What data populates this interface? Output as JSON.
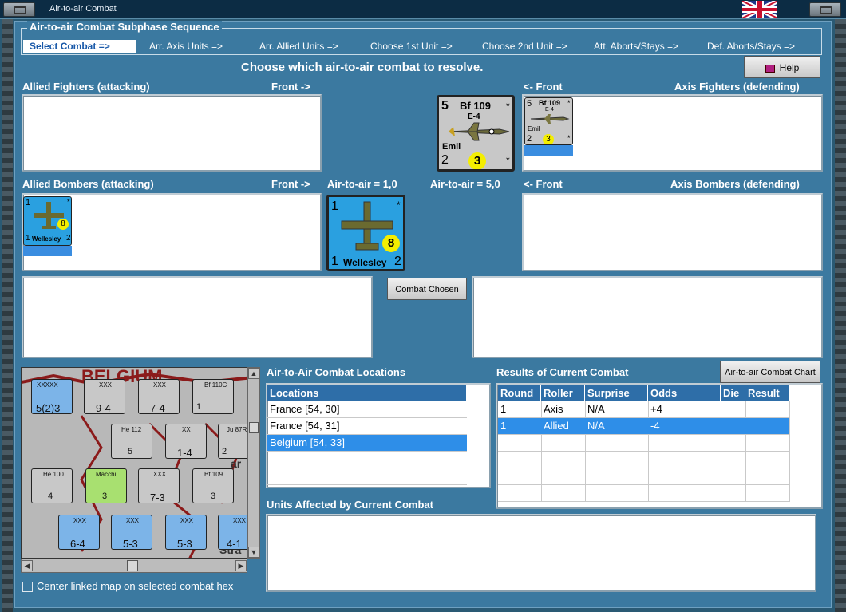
{
  "window": {
    "title": "Air-to-air Combat"
  },
  "sequence": {
    "legend": "Air-to-air Combat Subphase Sequence",
    "steps": [
      "Select Combat =>",
      "Arr. Axis Units =>",
      "Arr. Allied Units =>",
      "Choose 1st Unit =>",
      "Choose 2nd Unit =>",
      "Att. Aborts/Stays =>",
      "Def. Aborts/Stays =>"
    ]
  },
  "prompt": "Choose which air-to-air combat to resolve.",
  "help_button": "Help",
  "labels": {
    "allied_fighters": "Allied Fighters (attacking)",
    "front_right": "Front ->",
    "front_left": "<- Front",
    "axis_fighters": "Axis Fighters (defending)",
    "allied_bombers": "Allied Bombers (attacking)",
    "front_right_2": "Front ->",
    "air_allied": "Air-to-air = 1,0",
    "air_axis": "Air-to-air = 5,0",
    "front_left_2": "<- Front",
    "axis_bombers": "Axis Bombers (defending)",
    "combat_chosen": "Combat Chosen",
    "locations_title": "Air-to-Air Combat Locations",
    "results_title": "Results of Current Combat",
    "chart_button": "Air-to-air Combat Chart",
    "units_affected": "Units Affected by Current Combat",
    "center_map": "Center linked map on selected combat hex"
  },
  "units": {
    "bf109": {
      "name": "Bf 109",
      "model": "E-4",
      "pilot": "Emil",
      "air_to_air": "5",
      "range": "2",
      "cost": "3",
      "star": "*"
    },
    "wellesley": {
      "name": "Wellesley",
      "left": "1",
      "right": "2",
      "top": "1",
      "cost": "8",
      "star": "*"
    }
  },
  "locations": {
    "header": "Locations",
    "rows": [
      "France [54, 30]",
      "France [54, 31]",
      "Belgium [54, 33]"
    ],
    "selected": 2
  },
  "results": {
    "headers": [
      "Round",
      "Roller",
      "Surprise",
      "Odds",
      "Die",
      "Result"
    ],
    "rows": [
      [
        "1",
        "Axis",
        "N/A",
        "+4",
        "",
        ""
      ],
      [
        "1",
        "Allied",
        "N/A",
        "-4",
        "",
        ""
      ]
    ],
    "selected": 1
  },
  "map": {
    "units": [
      {
        "top": "XXXXX",
        "val": "5(2)3",
        "color": "#7cb4e8"
      },
      {
        "top": "XXX",
        "val": "9-4",
        "color": "#c8c8c8"
      },
      {
        "top": "XXX",
        "val": "7-4",
        "color": "#c8c8c8"
      },
      {
        "top": "Bf 110C",
        "val": "1",
        "color": "#c8c8c8"
      },
      {
        "top": "He 112",
        "val": "5",
        "color": "#c8c8c8"
      },
      {
        "top": "XX",
        "val": "1-4",
        "color": "#c8c8c8"
      },
      {
        "top": "Ju 87R",
        "val": "2",
        "color": "#c8c8c8"
      },
      {
        "top": "He 100",
        "val": "4",
        "color": "#c8c8c8"
      },
      {
        "top": "Macchi",
        "val": "3",
        "color": "#a8e070"
      },
      {
        "top": "XXX",
        "val": "7-3",
        "color": "#c8c8c8"
      },
      {
        "top": "Bf 109",
        "val": "3",
        "color": "#c8c8c8"
      },
      {
        "top": "XXX",
        "val": "6-4",
        "color": "#7cb4e8"
      },
      {
        "top": "XXX",
        "val": "5-3",
        "color": "#7cb4e8"
      },
      {
        "top": "XXX",
        "val": "5-3",
        "color": "#7cb4e8"
      },
      {
        "top": "XXX",
        "val": "4-1",
        "color": "#7cb4e8"
      }
    ],
    "map_text": [
      "BELGIUM",
      "Stra",
      "ar"
    ]
  },
  "colors": {
    "panel": "#3b79a0",
    "selection": "#2e8ee8",
    "header": "#2e6ea8"
  }
}
